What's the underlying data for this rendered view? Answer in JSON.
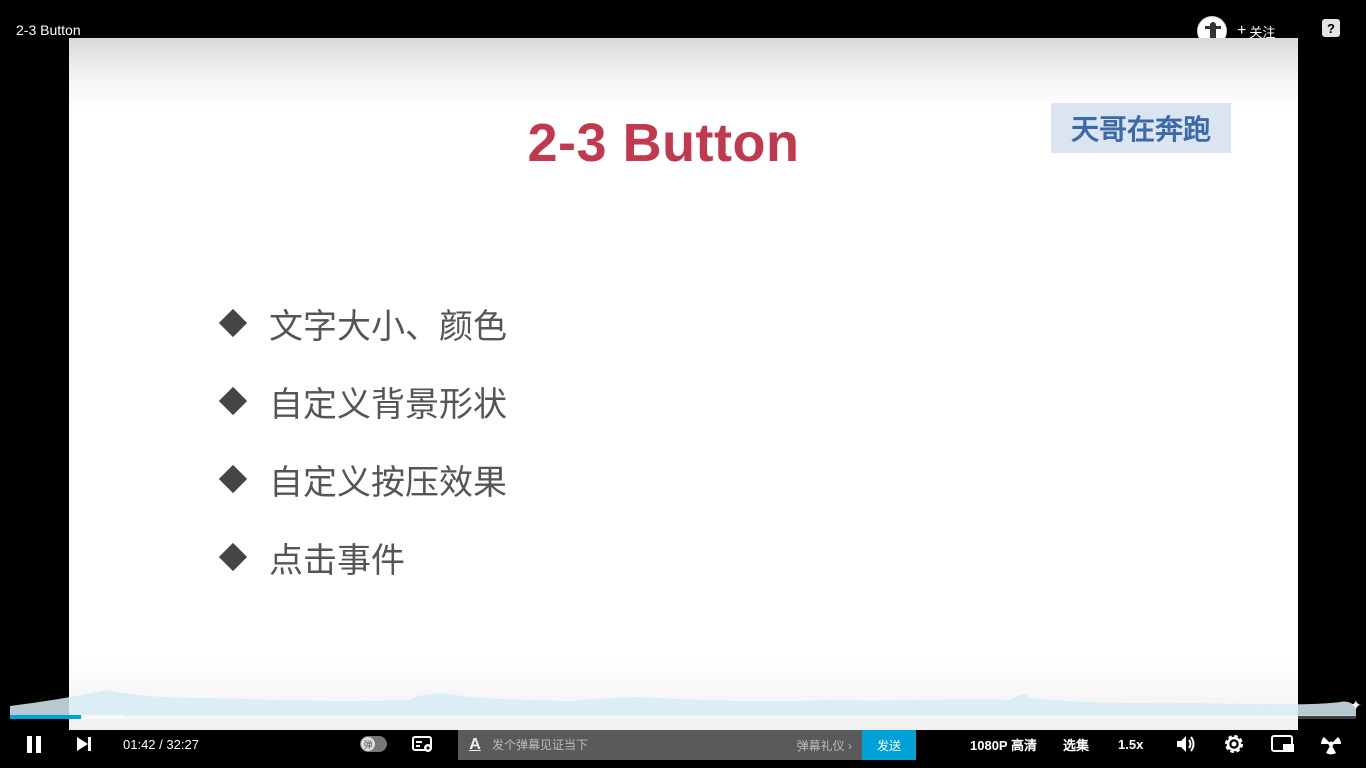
{
  "header": {
    "video_title": "2-3 Button",
    "follow_label": "关注",
    "help_symbol": "?"
  },
  "slide": {
    "title": "2-3 Button",
    "watermark": "天哥在奔跑",
    "bullets": [
      "文字大小、颜色",
      "自定义背景形状",
      "自定义按压效果",
      "点击事件"
    ]
  },
  "player": {
    "current_time": "01:42",
    "separator": " / ",
    "duration": "32:27",
    "progress_fraction": 0.0524,
    "buffered_fraction": 0.085,
    "danmu_toggle_label": "弹",
    "danmu_font_symbol": "A",
    "danmu_placeholder": "发个弹幕见证当下",
    "danmu_etiquette": "弹幕礼仪 ›",
    "send_label": "发送",
    "quality_label": "1080P 高清",
    "episodes_label": "选集",
    "speed_label": "1.5x"
  },
  "colors": {
    "accent": "#00a1d6",
    "title_red": "#c0394f",
    "watermark_blue": "#3b6aa6"
  },
  "icons": [
    "pause-icon",
    "next-icon",
    "danmu-settings-icon",
    "volume-icon",
    "gear-icon",
    "pip-icon",
    "fullscreen-icon"
  ]
}
